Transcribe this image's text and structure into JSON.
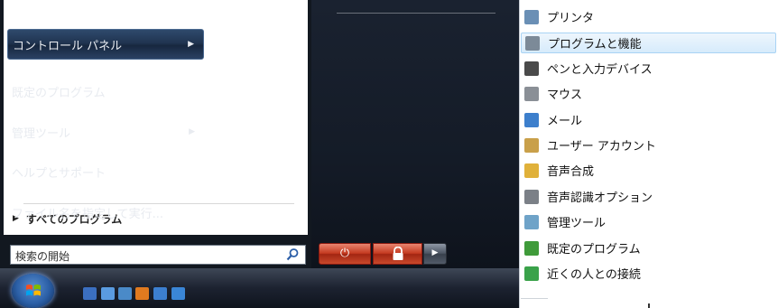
{
  "left": {
    "all_programs": "すべてのプログラム",
    "search_placeholder": "検索の開始"
  },
  "middle": {
    "items": [
      {
        "label": "コントロール パネル",
        "has_submenu": true,
        "highlighted": true
      },
      {
        "label": "既定のプログラム",
        "has_submenu": false
      },
      {
        "label": "管理ツール",
        "has_submenu": true
      },
      {
        "label": "ヘルプとサポート",
        "has_submenu": false
      },
      {
        "label": "ファイル名を指定して実行...",
        "has_submenu": false
      }
    ]
  },
  "submenu": {
    "items": [
      {
        "label": "プリンタ",
        "icon": "printer-icon",
        "color": "#6a8fb5"
      },
      {
        "label": "プログラムと機能",
        "icon": "programs-features-icon",
        "color": "#7c8a98",
        "highlighted": true
      },
      {
        "label": "ペンと入力デバイス",
        "icon": "pen-icon",
        "color": "#4a4a4a"
      },
      {
        "label": "マウス",
        "icon": "mouse-icon",
        "color": "#8a8f96"
      },
      {
        "label": "メール",
        "icon": "mail-icon",
        "color": "#3d7fcc"
      },
      {
        "label": "ユーザー アカウント",
        "icon": "user-accounts-icon",
        "color": "#c9a04a"
      },
      {
        "label": "音声合成",
        "icon": "speech-icon",
        "color": "#e0b13a"
      },
      {
        "label": "音声認識オプション",
        "icon": "microphone-icon",
        "color": "#7b8087"
      },
      {
        "label": "管理ツール",
        "icon": "admin-tools-icon",
        "color": "#6fa3c8"
      },
      {
        "label": "既定のプログラム",
        "icon": "default-programs-icon",
        "color": "#3f9b3a"
      },
      {
        "label": "近くの人との接続",
        "icon": "people-near-me-icon",
        "color": "#3aa24a"
      }
    ]
  },
  "taskbar": {
    "quick_launch": [
      {
        "icon": "word-icon",
        "color": "#3b6fc0"
      },
      {
        "icon": "messenger-icon",
        "color": "#5a9be0"
      },
      {
        "icon": "explorer-icon",
        "color": "#4a8ac8"
      },
      {
        "icon": "media-player-icon",
        "color": "#e07a1f"
      },
      {
        "icon": "desktop-icon",
        "color": "#3c7fd0"
      },
      {
        "icon": "internet-explorer-icon",
        "color": "#3a86d6"
      }
    ]
  }
}
